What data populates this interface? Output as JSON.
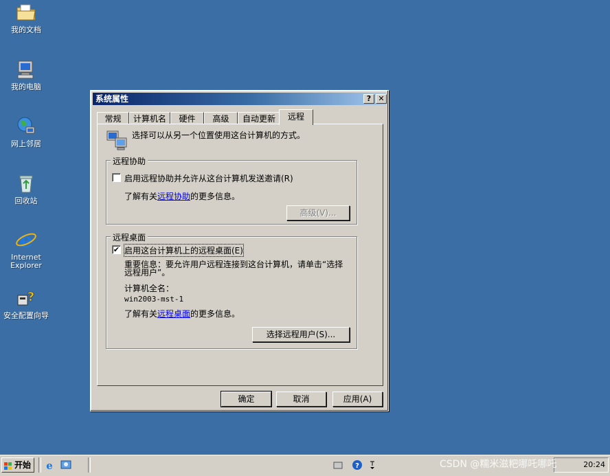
{
  "desktop": {
    "icons": [
      {
        "label": "我的文档",
        "icon": "my-documents-icon"
      },
      {
        "label": "我的电脑",
        "icon": "my-computer-icon"
      },
      {
        "label": "网上邻居",
        "icon": "network-places-icon"
      },
      {
        "label": "回收站",
        "icon": "recycle-bin-icon"
      },
      {
        "label": "Internet\nExplorer",
        "icon": "internet-explorer-icon"
      },
      {
        "label": "安全配置向导",
        "icon": "security-wizard-icon"
      }
    ]
  },
  "window": {
    "title": "系统属性",
    "help_btn": "?",
    "close_btn": "✕",
    "tabs": [
      "常规",
      "计算机名",
      "硬件",
      "高级",
      "自动更新",
      "远程"
    ],
    "active_tab": "远程",
    "intro": "选择可以从另一个位置使用这台计算机的方式。",
    "remote_assist": {
      "title": "远程协助",
      "checkbox_label": "启用远程协助并允许从这台计算机发送邀请(R)",
      "checked": false,
      "info_prefix": "了解有关",
      "info_link": "远程协助",
      "info_suffix": "的更多信息。",
      "advanced_btn": "高级(V)..."
    },
    "remote_desktop": {
      "title": "远程桌面",
      "checkbox_label": "启用这台计算机上的远程桌面(E)",
      "checked": true,
      "important_line1": "重要信息：要允许用户远程连接到这台计算机，请单击“选择",
      "important_line2": "远程用户”。",
      "fullname_label": "计算机全名：",
      "fullname_value": "win2003-mst-1",
      "info_prefix": "了解有关",
      "info_link": "远程桌面",
      "info_suffix": "的更多信息。",
      "select_users_btn": "选择远程用户(S)..."
    },
    "footer": {
      "ok": "确定",
      "cancel": "取消",
      "apply": "应用(A)"
    }
  },
  "taskbar": {
    "start_label": "开始",
    "clock": "20:24"
  },
  "watermark": "CSDN @糯米滋粑哪吒哪吒",
  "colors": {
    "desktop": "#3a6ea5",
    "title_active": "#0a246a",
    "face": "#d4d0c8"
  }
}
